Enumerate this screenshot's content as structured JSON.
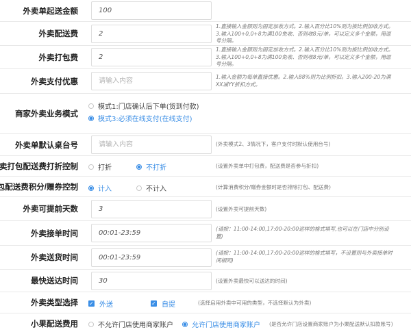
{
  "rows": [
    {
      "label": "外卖单起送金额",
      "value": "100"
    },
    {
      "label": "外卖配送费",
      "value": "2",
      "hint": "1.直接输入金额则为固定加收方式。2.输入百分比10%则为按比例加收方式。3.输入100+0,0+8为满100免收、否则收8元/单，可以定义多个金额，用逗号分隔。"
    },
    {
      "label": "外卖打包费",
      "value": "2",
      "hint": "1.直接输入金额则为固定加收方式。2.输入百分比10%则为按比例加收方式。3.输入100+0,0+8为满100免收、否则收8元/单，可以定义多个金额，用逗号分隔。"
    },
    {
      "label": "外卖支付优惠",
      "placeholder": "请输入内容",
      "hint": "1.输入金额为每单直接优惠。2.输入88%则为比例折扣。3.输入200-20为满XX减YY折扣方式。"
    },
    {
      "label": "商家外卖业务模式",
      "options": [
        "模式1:门店确认后下单(货到付款)",
        "模式3:必须在线支付(在线支付)"
      ]
    },
    {
      "label": "外卖单默认桌台号",
      "placeholder": "请输入内容",
      "hint": "(外卖模式2、3情况下，客户支付时默认使用台号)"
    },
    {
      "label": "外卖打包配送费打折控制",
      "options": [
        "打折",
        "不打折"
      ],
      "hint": "(设置外卖单中打包费，配送费是否参与折扣)"
    },
    {
      "label": "打包配送费积分/赠券控制",
      "options": [
        "计入",
        "不计入"
      ],
      "hint": "(计算消费积分/赠券金额时是否排除打包、配送费)"
    },
    {
      "label": "外卖可提前天数",
      "value": "3",
      "hint": "(设置外卖可提前天数)"
    },
    {
      "label": "外卖接单时间",
      "value": "00:01-23:59",
      "hint": "(请按：11:00-14:00,17:00-20:00这样的格式填写,也可以在门店中分别设置)"
    },
    {
      "label": "外卖送货时间",
      "value": "00:01-23:59",
      "hint": "(请按：11:00-14:00,17:00-20:00这样的格式填写，不设置则与外卖接单时间相同)"
    },
    {
      "label": "最快送达时间",
      "value": "30",
      "hint": "(设置外卖最快可以送达的时间)"
    },
    {
      "label": "外卖类型选择",
      "checks": [
        "外送",
        "自提"
      ],
      "hint": "(选择启用外卖中可用的类型，不选择默认为外卖)"
    },
    {
      "label": "小果配送费用",
      "options": [
        "不允许门店使用商家账户",
        "允许门店使用商家账户"
      ],
      "hint": "(是否允许门店设置商家账户为小果配送默认扣款账号)"
    }
  ],
  "colors": {
    "accent": "#3a8ee6",
    "border": "#e8e8e8"
  }
}
